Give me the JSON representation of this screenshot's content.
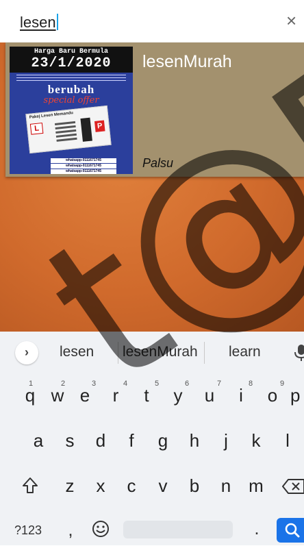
{
  "search": {
    "query": "lesen",
    "clear_icon": "×"
  },
  "result": {
    "title": "lesenMurah",
    "subtitle": "Palsu",
    "thumbnail": {
      "header_line1": "Harga Baru Bermula",
      "header_line2": "23/1/2020",
      "headline": "berubah",
      "tagline": "special offer",
      "pakej_title": "Pakej Lesen Memandu",
      "whatsapp": [
        "whatsapp-0111671745",
        "whatsapp-0111671745",
        "whatsapp-0111671745"
      ]
    }
  },
  "suggestions": {
    "items": [
      "lesen",
      "lesenMurah",
      "learn"
    ]
  },
  "keyboard": {
    "row1": [
      "q",
      "w",
      "e",
      "r",
      "t",
      "y",
      "u",
      "i",
      "o",
      "p"
    ],
    "row1_hints": [
      "1",
      "2",
      "3",
      "4",
      "5",
      "6",
      "7",
      "8",
      "9"
    ],
    "row2": [
      "a",
      "s",
      "d",
      "f",
      "g",
      "h",
      "j",
      "k",
      "l"
    ],
    "row3": [
      "z",
      "x",
      "c",
      "v",
      "b",
      "n",
      "m"
    ],
    "sym_label": "?123",
    "comma": ",",
    "period": "."
  },
  "watermark_text": "t@FTS"
}
